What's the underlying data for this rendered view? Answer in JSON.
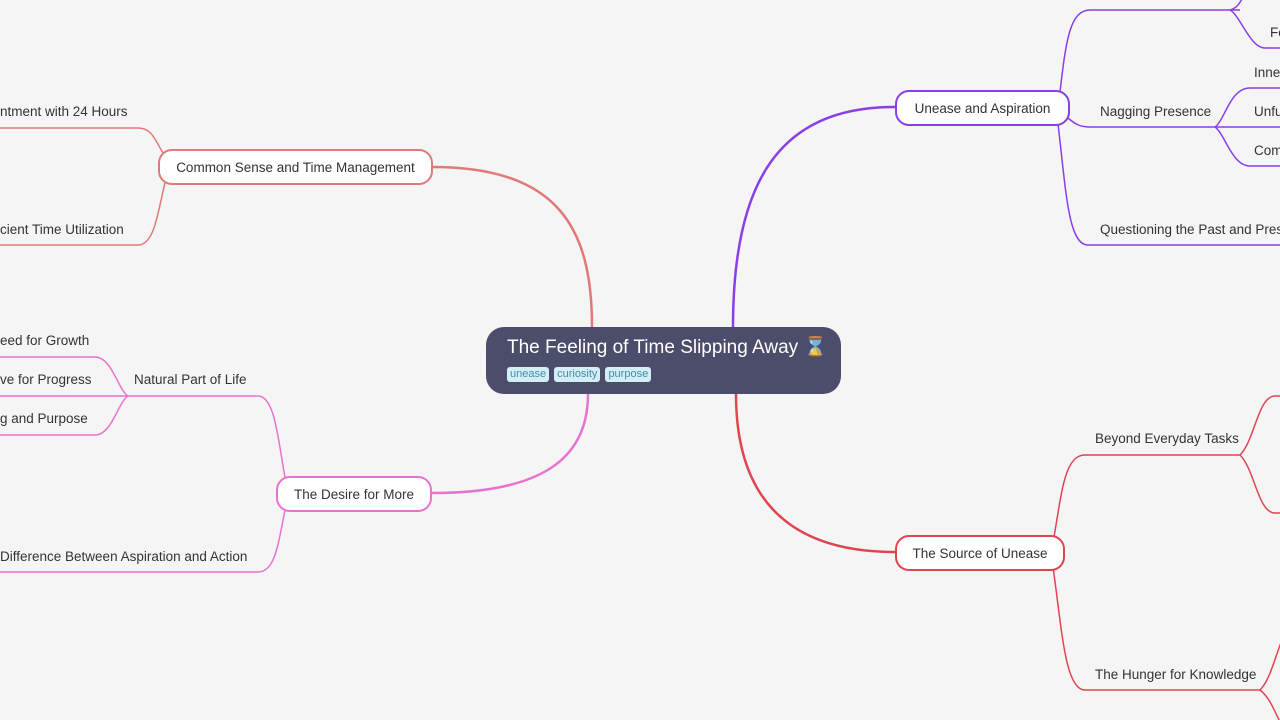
{
  "root": {
    "title": "The Feeling of Time Slipping Away",
    "emoji": "⌛",
    "tags": [
      "unease",
      "curiosity",
      "purpose"
    ]
  },
  "colors": {
    "purple": "#8a3fe6",
    "coral": "#e07a78",
    "pink": "#e873cf",
    "red": "#e0454f",
    "root_bg": "#4b4d6a",
    "tag_bg": "#d3eef7",
    "tag_text": "#4a8aa8"
  },
  "branches": {
    "unease_aspiration": {
      "label": "Unease and Aspiration",
      "children": {
        "top_partial": "Fe",
        "nagging": "Nagging Presence",
        "nagging_children": [
          "Inne",
          "Unfu",
          "Com"
        ],
        "questioning": "Questioning the Past and Prese"
      }
    },
    "common_sense": {
      "label": "Common Sense and Time Management",
      "children": [
        "ntment with 24 Hours",
        "cient Time Utilization"
      ]
    },
    "desire_more": {
      "label": "The Desire for More",
      "natural": "Natural Part of Life",
      "natural_children": [
        "eed for Growth",
        "ve for Progress",
        "g and Purpose"
      ],
      "difference": "Difference Between Aspiration and Action"
    },
    "source_unease": {
      "label": "The Source of Unease",
      "beyond": "Beyond Everyday Tasks",
      "hunger": "The Hunger for Knowledge"
    }
  }
}
